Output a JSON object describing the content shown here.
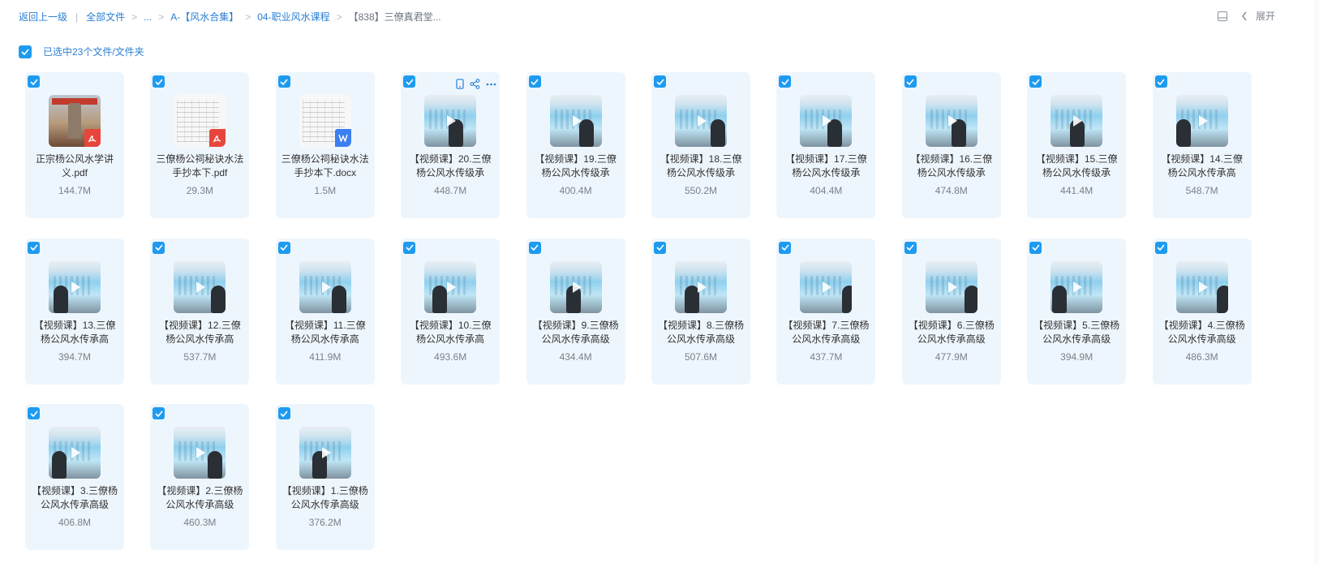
{
  "breadcrumb": {
    "back": "返回上一级",
    "items": [
      "全部文件",
      "...",
      "A-【风水合集】",
      "04-职业风水课程"
    ],
    "current": "【838】三僚真君堂..."
  },
  "top_right": {
    "expand": "展开"
  },
  "selection": {
    "text": "已选中23个文件/文件夹"
  },
  "files": [
    {
      "name": "正宗杨公风水学讲义.pdf",
      "size": "144.7M",
      "type": "pdf"
    },
    {
      "name": "三僚杨公祠秘诀水法手抄本下.pdf",
      "size": "29.3M",
      "type": "pdf"
    },
    {
      "name": "三僚杨公祠秘诀水法手抄本下.docx",
      "size": "1.5M",
      "type": "docx"
    },
    {
      "name": "【视频课】20.三僚杨公风水传级承",
      "size": "448.7M",
      "type": "video"
    },
    {
      "name": "【视频课】19.三僚杨公风水传级承",
      "size": "400.4M",
      "type": "video"
    },
    {
      "name": "【视频课】18.三僚杨公风水传级承",
      "size": "550.2M",
      "type": "video"
    },
    {
      "name": "【视频课】17.三僚杨公风水传级承",
      "size": "404.4M",
      "type": "video"
    },
    {
      "name": "【视频课】16.三僚杨公风水传级承",
      "size": "474.8M",
      "type": "video"
    },
    {
      "name": "【视频课】15.三僚杨公风水传级承",
      "size": "441.4M",
      "type": "video"
    },
    {
      "name": "【视频课】14.三僚杨公风水传承高",
      "size": "548.7M",
      "type": "video"
    },
    {
      "name": "【视频课】13.三僚杨公风水传承高",
      "size": "394.7M",
      "type": "video"
    },
    {
      "name": "【视频课】12.三僚杨公风水传承高",
      "size": "537.7M",
      "type": "video"
    },
    {
      "name": "【视频课】11.三僚杨公风水传承高",
      "size": "411.9M",
      "type": "video"
    },
    {
      "name": "【视频课】10.三僚杨公风水传承高",
      "size": "493.6M",
      "type": "video"
    },
    {
      "name": "【视频课】9.三僚杨公风水传承高级",
      "size": "434.4M",
      "type": "video"
    },
    {
      "name": "【视频课】8.三僚杨公风水传承高级",
      "size": "507.6M",
      "type": "video"
    },
    {
      "name": "【视频课】7.三僚杨公风水传承高级",
      "size": "437.7M",
      "type": "video"
    },
    {
      "name": "【视频课】6.三僚杨公风水传承高级",
      "size": "477.9M",
      "type": "video"
    },
    {
      "name": "【视频课】5.三僚杨公风水传承高级",
      "size": "394.9M",
      "type": "video"
    },
    {
      "name": "【视频课】4.三僚杨公风水传承高级",
      "size": "486.3M",
      "type": "video"
    },
    {
      "name": "【视频课】3.三僚杨公风水传承高级",
      "size": "406.8M",
      "type": "video"
    },
    {
      "name": "【视频课】2.三僚杨公风水传承高级",
      "size": "460.3M",
      "type": "video"
    },
    {
      "name": "【视频课】1.三僚杨公风水传承高级",
      "size": "376.2M",
      "type": "video"
    }
  ],
  "colors": {
    "accent": "#1e9bf0",
    "card_bg": "#eef6fd",
    "link": "#2a7fd4"
  },
  "hover_actions": [
    "phone-icon",
    "share-icon",
    "more-icon"
  ]
}
